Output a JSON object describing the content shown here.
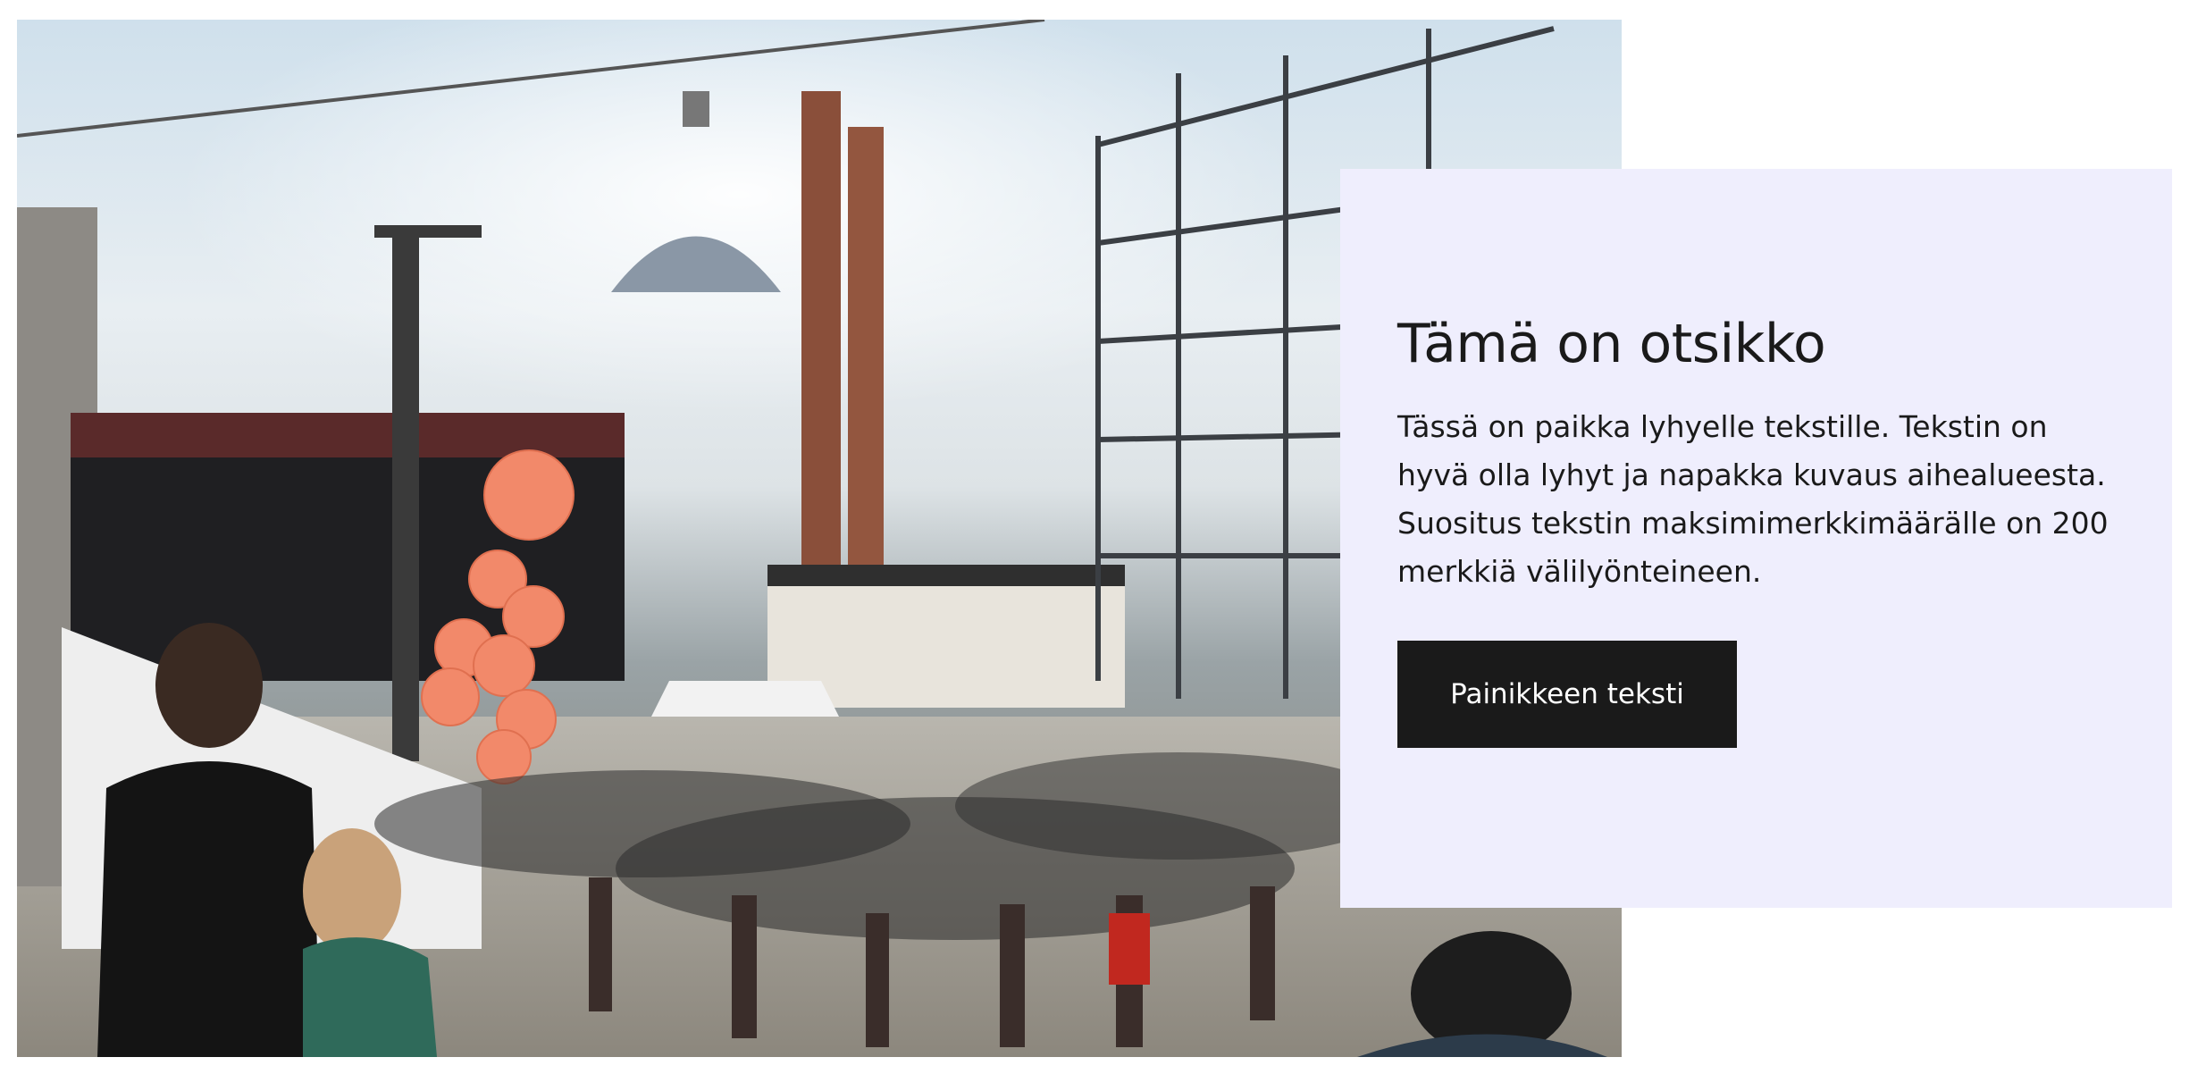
{
  "hero": {
    "image_alt": "Crowd at an outdoor festival with orange balloons, stage lights, brick chimneys and a steel gas holder"
  },
  "card": {
    "title": "Tämä on otsikko",
    "text": "Tässä on paikka lyhyelle tekstille. Tekstin on hyvä olla lyhyt ja napakka kuvaus aihealueesta. Suositus tekstin maksimimerkkimäärälle on 200 merkkiä välilyönteineen.",
    "button_label": "Painikkeen teksti"
  },
  "colors": {
    "card_background": "#efeefd",
    "button_background": "#1a1a1a",
    "button_text": "#ffffff",
    "text": "#1a1a1a"
  }
}
